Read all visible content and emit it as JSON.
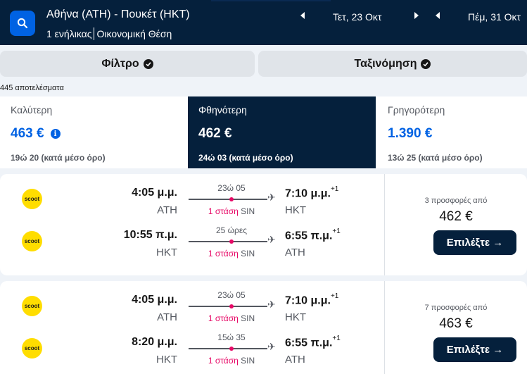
{
  "header": {
    "route": "Αθήνα (ATH) - Πουκέτ (HKT)",
    "passengers": "1 ενήλικας",
    "cabin": "Οικονομική Θέση",
    "depart_date": "Τετ, 23 Οκτ",
    "return_date": "Πέμ, 31 Οκτ",
    "icons": [
      "search-icon",
      "chevron-left-icon",
      "chevron-right-icon"
    ]
  },
  "toolbar": {
    "filter_label": "Φίλτρο",
    "sort_label": "Ταξινόμηση"
  },
  "results_count": "445 αποτελέσματα",
  "sort": {
    "best": {
      "label": "Καλύτερη",
      "price": "463 €",
      "duration": "19ώ 20 (κατά μέσο όρο)"
    },
    "cheapest": {
      "label": "Φθηνότερη",
      "price": "462 €",
      "duration": "24ώ 03 (κατά μέσο όρο)"
    },
    "fastest": {
      "label": "Γρηγορότερη",
      "price": "1.390 €",
      "duration": "13ώ 25 (κατά μέσο όρο)"
    },
    "active": "cheapest"
  },
  "results": [
    {
      "airline_logo": "scoot",
      "legs": [
        {
          "dep_time": "4:05 μ.μ.",
          "dep_code": "ATH",
          "duration": "23ώ 05",
          "stops": "1 στάση",
          "via": "SIN",
          "arr_time": "7:10 μ.μ.",
          "day_offset": "+1",
          "arr_code": "HKT"
        },
        {
          "dep_time": "10:55 π.μ.",
          "dep_code": "HKT",
          "duration": "25 ώρες",
          "stops": "1 στάση",
          "via": "SIN",
          "arr_time": "6:55 π.μ.",
          "day_offset": "+1",
          "arr_code": "ATH"
        }
      ],
      "offers": "3 προσφορές από",
      "price": "462 €",
      "select_label": "Επιλέξτε →"
    },
    {
      "airline_logo": "scoot",
      "legs": [
        {
          "dep_time": "4:05 μ.μ.",
          "dep_code": "ATH",
          "duration": "23ώ 05",
          "stops": "1 στάση",
          "via": "SIN",
          "arr_time": "7:10 μ.μ.",
          "day_offset": "+1",
          "arr_code": "HKT"
        },
        {
          "dep_time": "8:20 μ.μ.",
          "dep_code": "HKT",
          "duration": "15ώ 35",
          "stops": "1 στάση",
          "via": "SIN",
          "arr_time": "6:55 π.μ.",
          "day_offset": "+1",
          "arr_code": "ATH"
        }
      ],
      "offers": "7 προσφορές από",
      "price": "463 €",
      "select_label": "Επιλέξτε →"
    }
  ],
  "colors": {
    "header_bg": "#05203c",
    "accent_blue": "#0062e3",
    "stop_pink": "#e70866",
    "airline_yellow": "#ffdd00"
  }
}
